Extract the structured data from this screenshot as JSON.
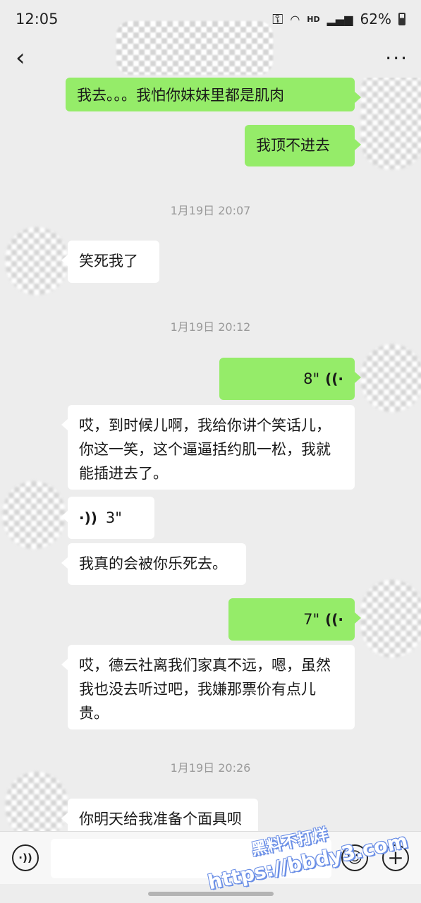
{
  "status_bar": {
    "time": "12:05",
    "hd": "HD",
    "battery": "62%",
    "icons": [
      "key-icon",
      "wifi-icon",
      "signal-icon",
      "battery-icon"
    ]
  },
  "nav": {
    "back_icon": "‹",
    "more_icon": "···"
  },
  "messages": [
    {
      "type": "text",
      "side": "out",
      "text": "我去。。。我怕你妹妹里都是肌肉"
    },
    {
      "type": "text",
      "side": "out",
      "text": "我顶不进去"
    },
    {
      "type": "time",
      "text": "1月19日 20:07"
    },
    {
      "type": "text",
      "side": "in",
      "text": "笑死我了"
    },
    {
      "type": "time",
      "text": "1月19日 20:12"
    },
    {
      "type": "voice",
      "side": "out",
      "duration": "8\""
    },
    {
      "type": "text",
      "side": "in",
      "text": "哎，到时候儿啊，我给你讲个笑话儿，你这一笑，这个逼逼括约肌一松，我就能插进去了。"
    },
    {
      "type": "voice",
      "side": "in",
      "duration": "3\""
    },
    {
      "type": "text",
      "side": "in",
      "text": "我真的会被你乐死去。"
    },
    {
      "type": "voice",
      "side": "out",
      "duration": "7\""
    },
    {
      "type": "text",
      "side": "in",
      "text": "哎，德云社离我们家真不远，嗯，虽然我也没去听过吧，我嫌那票价有点儿贵。"
    },
    {
      "type": "time",
      "text": "1月19日 20:26"
    },
    {
      "type": "text",
      "side": "in",
      "text": "你明天给我准备个面具呗"
    }
  ],
  "input_bar": {
    "voice_button_icon": "voice-icon",
    "emoji_button_icon": "emoji-icon",
    "add_button_icon": "plus-icon"
  },
  "watermark": {
    "line1": "黑料不打烊",
    "line2": "https://bbdy3.com"
  }
}
